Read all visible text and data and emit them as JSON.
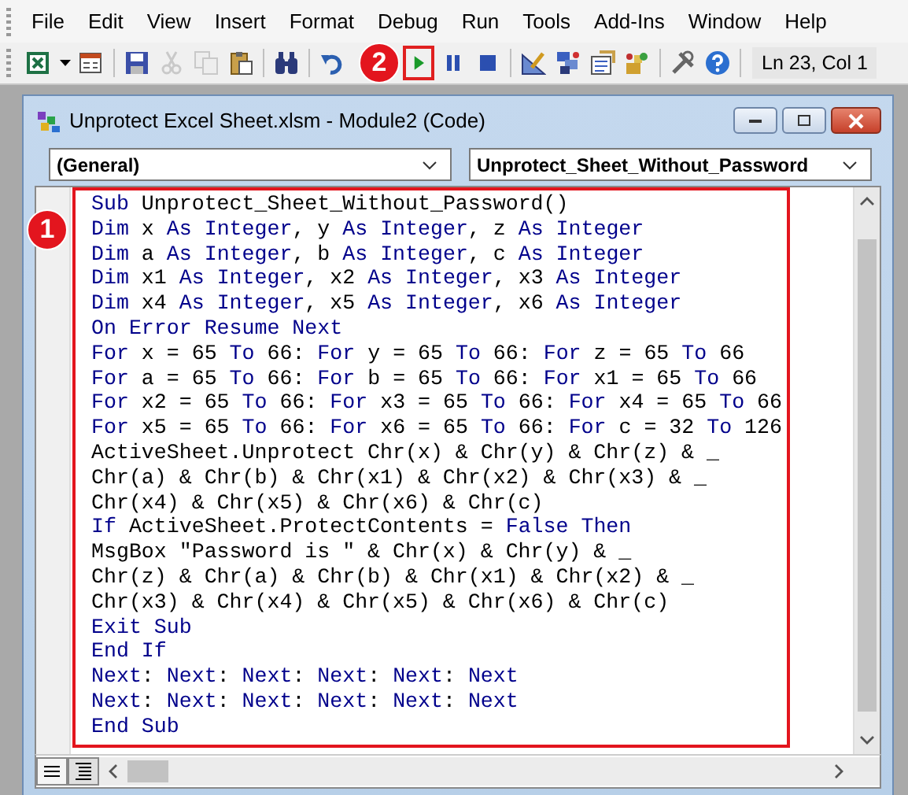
{
  "menu": [
    {
      "label": "File"
    },
    {
      "label": "Edit"
    },
    {
      "label": "View"
    },
    {
      "label": "Insert"
    },
    {
      "label": "Format"
    },
    {
      "label": "Debug"
    },
    {
      "label": "Run"
    },
    {
      "label": "Tools"
    },
    {
      "label": "Add-Ins"
    },
    {
      "label": "Window"
    },
    {
      "label": "Help"
    }
  ],
  "toolbar": {
    "buttons": [
      {
        "disabled": false,
        "highlighted": false
      },
      {
        "disabled": false,
        "highlighted": false
      },
      {
        "disabled": false,
        "highlighted": false
      },
      {
        "disabled": true,
        "highlighted": false
      },
      {
        "disabled": true,
        "highlighted": false
      },
      {
        "disabled": false,
        "highlighted": false
      },
      {
        "disabled": false,
        "highlighted": false
      },
      {
        "disabled": false,
        "highlighted": false
      },
      {
        "disabled": false,
        "highlighted": true
      },
      {
        "disabled": false,
        "highlighted": false
      },
      {
        "disabled": false,
        "highlighted": false
      },
      {
        "disabled": false,
        "highlighted": false
      },
      {
        "disabled": false,
        "highlighted": false
      },
      {
        "disabled": false,
        "highlighted": false
      },
      {
        "disabled": false,
        "highlighted": false
      },
      {
        "disabled": false,
        "highlighted": false
      },
      {
        "disabled": false,
        "highlighted": false
      }
    ],
    "position": "Ln 23, Col 1"
  },
  "window": {
    "title": "Unprotect Excel Sheet.xlsm - Module2 (Code)"
  },
  "object_combo": {
    "value": "(General)"
  },
  "procedure_combo": {
    "value": "Unprotect_Sheet_Without_Password"
  },
  "code": [
    {
      "segments": [
        {
          "kind": "keyword",
          "text": "Sub"
        },
        {
          "kind": "plain",
          "text": " Unprotect_Sheet_Without_Password()"
        }
      ]
    },
    {
      "segments": [
        {
          "kind": "keyword",
          "text": "Dim"
        },
        {
          "kind": "plain",
          "text": " x "
        },
        {
          "kind": "keyword",
          "text": "As Integer"
        },
        {
          "kind": "plain",
          "text": ", y "
        },
        {
          "kind": "keyword",
          "text": "As Integer"
        },
        {
          "kind": "plain",
          "text": ", z "
        },
        {
          "kind": "keyword",
          "text": "As Integer"
        }
      ]
    },
    {
      "segments": [
        {
          "kind": "keyword",
          "text": "Dim"
        },
        {
          "kind": "plain",
          "text": " a "
        },
        {
          "kind": "keyword",
          "text": "As Integer"
        },
        {
          "kind": "plain",
          "text": ", b "
        },
        {
          "kind": "keyword",
          "text": "As Integer"
        },
        {
          "kind": "plain",
          "text": ", c "
        },
        {
          "kind": "keyword",
          "text": "As Integer"
        }
      ]
    },
    {
      "segments": [
        {
          "kind": "keyword",
          "text": "Dim"
        },
        {
          "kind": "plain",
          "text": " x1 "
        },
        {
          "kind": "keyword",
          "text": "As Integer"
        },
        {
          "kind": "plain",
          "text": ", x2 "
        },
        {
          "kind": "keyword",
          "text": "As Integer"
        },
        {
          "kind": "plain",
          "text": ", x3 "
        },
        {
          "kind": "keyword",
          "text": "As Integer"
        }
      ]
    },
    {
      "segments": [
        {
          "kind": "keyword",
          "text": "Dim"
        },
        {
          "kind": "plain",
          "text": " x4 "
        },
        {
          "kind": "keyword",
          "text": "As Integer"
        },
        {
          "kind": "plain",
          "text": ", x5 "
        },
        {
          "kind": "keyword",
          "text": "As Integer"
        },
        {
          "kind": "plain",
          "text": ", x6 "
        },
        {
          "kind": "keyword",
          "text": "As Integer"
        }
      ]
    },
    {
      "segments": [
        {
          "kind": "keyword",
          "text": "On Error Resume Next"
        }
      ]
    },
    {
      "segments": [
        {
          "kind": "keyword",
          "text": "For"
        },
        {
          "kind": "plain",
          "text": " x = 65 "
        },
        {
          "kind": "keyword",
          "text": "To"
        },
        {
          "kind": "plain",
          "text": " 66: "
        },
        {
          "kind": "keyword",
          "text": "For"
        },
        {
          "kind": "plain",
          "text": " y = 65 "
        },
        {
          "kind": "keyword",
          "text": "To"
        },
        {
          "kind": "plain",
          "text": " 66: "
        },
        {
          "kind": "keyword",
          "text": "For"
        },
        {
          "kind": "plain",
          "text": " z = 65 "
        },
        {
          "kind": "keyword",
          "text": "To"
        },
        {
          "kind": "plain",
          "text": " 66"
        }
      ]
    },
    {
      "segments": [
        {
          "kind": "keyword",
          "text": "For"
        },
        {
          "kind": "plain",
          "text": " a = 65 "
        },
        {
          "kind": "keyword",
          "text": "To"
        },
        {
          "kind": "plain",
          "text": " 66: "
        },
        {
          "kind": "keyword",
          "text": "For"
        },
        {
          "kind": "plain",
          "text": " b = 65 "
        },
        {
          "kind": "keyword",
          "text": "To"
        },
        {
          "kind": "plain",
          "text": " 66: "
        },
        {
          "kind": "keyword",
          "text": "For"
        },
        {
          "kind": "plain",
          "text": " x1 = 65 "
        },
        {
          "kind": "keyword",
          "text": "To"
        },
        {
          "kind": "plain",
          "text": " 66"
        }
      ]
    },
    {
      "segments": [
        {
          "kind": "keyword",
          "text": "For"
        },
        {
          "kind": "plain",
          "text": " x2 = 65 "
        },
        {
          "kind": "keyword",
          "text": "To"
        },
        {
          "kind": "plain",
          "text": " 66: "
        },
        {
          "kind": "keyword",
          "text": "For"
        },
        {
          "kind": "plain",
          "text": " x3 = 65 "
        },
        {
          "kind": "keyword",
          "text": "To"
        },
        {
          "kind": "plain",
          "text": " 66: "
        },
        {
          "kind": "keyword",
          "text": "For"
        },
        {
          "kind": "plain",
          "text": " x4 = 65 "
        },
        {
          "kind": "keyword",
          "text": "To"
        },
        {
          "kind": "plain",
          "text": " 66"
        }
      ]
    },
    {
      "segments": [
        {
          "kind": "keyword",
          "text": "For"
        },
        {
          "kind": "plain",
          "text": " x5 = 65 "
        },
        {
          "kind": "keyword",
          "text": "To"
        },
        {
          "kind": "plain",
          "text": " 66: "
        },
        {
          "kind": "keyword",
          "text": "For"
        },
        {
          "kind": "plain",
          "text": " x6 = 65 "
        },
        {
          "kind": "keyword",
          "text": "To"
        },
        {
          "kind": "plain",
          "text": " 66: "
        },
        {
          "kind": "keyword",
          "text": "For"
        },
        {
          "kind": "plain",
          "text": " c = 32 "
        },
        {
          "kind": "keyword",
          "text": "To"
        },
        {
          "kind": "plain",
          "text": " 126"
        }
      ]
    },
    {
      "segments": [
        {
          "kind": "plain",
          "text": "ActiveSheet.Unprotect Chr(x) & Chr(y) & Chr(z) & _"
        }
      ]
    },
    {
      "segments": [
        {
          "kind": "plain",
          "text": "Chr(a) & Chr(b) & Chr(x1) & Chr(x2) & Chr(x3) & _"
        }
      ]
    },
    {
      "segments": [
        {
          "kind": "plain",
          "text": "Chr(x4) & Chr(x5) & Chr(x6) & Chr(c)"
        }
      ]
    },
    {
      "segments": [
        {
          "kind": "keyword",
          "text": "If"
        },
        {
          "kind": "plain",
          "text": " ActiveSheet.ProtectContents = "
        },
        {
          "kind": "keyword",
          "text": "False Then"
        }
      ]
    },
    {
      "segments": [
        {
          "kind": "plain",
          "text": "MsgBox \"Password is \" & Chr(x) & Chr(y) & _"
        }
      ]
    },
    {
      "segments": [
        {
          "kind": "plain",
          "text": "Chr(z) & Chr(a) & Chr(b) & Chr(x1) & Chr(x2) & _"
        }
      ]
    },
    {
      "segments": [
        {
          "kind": "plain",
          "text": "Chr(x3) & Chr(x4) & Chr(x5) & Chr(x6) & Chr(c)"
        }
      ]
    },
    {
      "segments": [
        {
          "kind": "keyword",
          "text": "Exit Sub"
        }
      ]
    },
    {
      "segments": [
        {
          "kind": "keyword",
          "text": "End If"
        }
      ]
    },
    {
      "segments": [
        {
          "kind": "keyword",
          "text": "Next"
        },
        {
          "kind": "plain",
          "text": ": "
        },
        {
          "kind": "keyword",
          "text": "Next"
        },
        {
          "kind": "plain",
          "text": ": "
        },
        {
          "kind": "keyword",
          "text": "Next"
        },
        {
          "kind": "plain",
          "text": ": "
        },
        {
          "kind": "keyword",
          "text": "Next"
        },
        {
          "kind": "plain",
          "text": ": "
        },
        {
          "kind": "keyword",
          "text": "Next"
        },
        {
          "kind": "plain",
          "text": ": "
        },
        {
          "kind": "keyword",
          "text": "Next"
        }
      ]
    },
    {
      "segments": [
        {
          "kind": "keyword",
          "text": "Next"
        },
        {
          "kind": "plain",
          "text": ": "
        },
        {
          "kind": "keyword",
          "text": "Next"
        },
        {
          "kind": "plain",
          "text": ": "
        },
        {
          "kind": "keyword",
          "text": "Next"
        },
        {
          "kind": "plain",
          "text": ": "
        },
        {
          "kind": "keyword",
          "text": "Next"
        },
        {
          "kind": "plain",
          "text": ": "
        },
        {
          "kind": "keyword",
          "text": "Next"
        },
        {
          "kind": "plain",
          "text": ": "
        },
        {
          "kind": "keyword",
          "text": "Next"
        }
      ]
    },
    {
      "segments": [
        {
          "kind": "keyword",
          "text": "End Sub"
        }
      ]
    }
  ],
  "annotations": [
    {
      "label": "1"
    },
    {
      "label": "2"
    }
  ]
}
